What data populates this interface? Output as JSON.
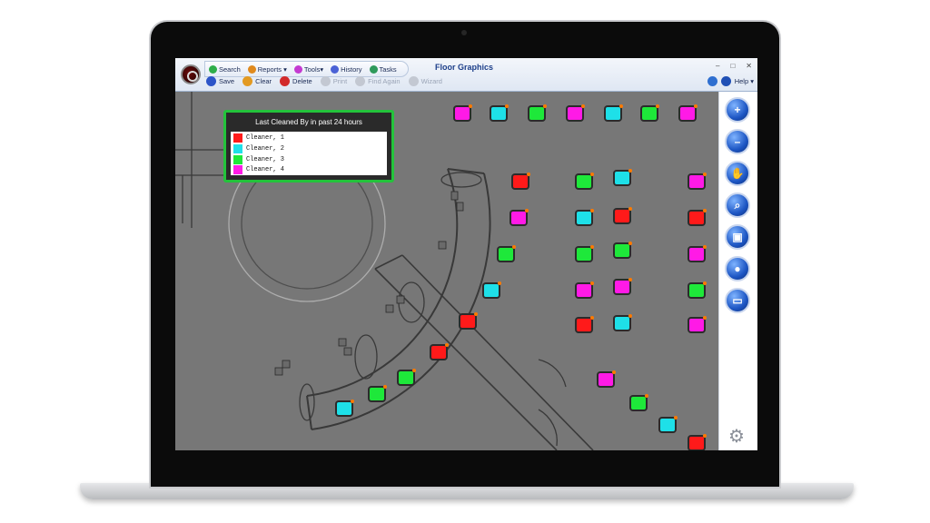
{
  "app": {
    "title": "Floor Graphics",
    "quick_access": [
      {
        "label": "Search",
        "icon": "search-icon"
      },
      {
        "label": "Reports ▾",
        "icon": "reports-icon"
      },
      {
        "label": "Tools▾",
        "icon": "tools-icon"
      },
      {
        "label": "History",
        "icon": "history-icon"
      },
      {
        "label": "Tasks",
        "icon": "tasks-icon"
      }
    ],
    "window_controls": [
      "–",
      "□",
      "✕"
    ]
  },
  "toolbar": {
    "save_label": "Save",
    "clear_label": "Clear",
    "delete_label": "Delete",
    "disabled_1": "Print",
    "disabled_2": "Find Again",
    "disabled_3": "Wizard",
    "help_label": "Help ▾"
  },
  "legend": {
    "title": "Last Cleaned By in past 24 hours",
    "items": [
      {
        "label": "Cleaner, 1",
        "color": "#ff1a1a"
      },
      {
        "label": "Cleaner, 2",
        "color": "#1ee0e8"
      },
      {
        "label": "Cleaner, 3",
        "color": "#1ee83a"
      },
      {
        "label": "Cleaner, 4",
        "color": "#ff1ae6"
      }
    ]
  },
  "right_tools": [
    {
      "name": "zoom-in-icon",
      "glyph": "+"
    },
    {
      "name": "zoom-out-icon",
      "glyph": "–"
    },
    {
      "name": "pan-hand-icon",
      "glyph": "✋"
    },
    {
      "name": "magnifier-icon",
      "glyph": "⌕"
    },
    {
      "name": "layers-icon",
      "glyph": "▣"
    },
    {
      "name": "user-icon",
      "glyph": "●"
    },
    {
      "name": "screen-icon",
      "glyph": "▭"
    }
  ],
  "colors": {
    "cleaner1": "#ff1a1a",
    "cleaner2": "#1ee0e8",
    "cleaner3": "#1ee83a",
    "cleaner4": "#ff1ae6",
    "legend_border": "#23c33b"
  }
}
